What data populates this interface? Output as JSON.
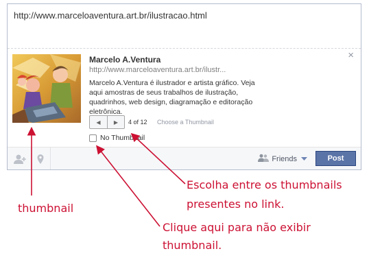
{
  "composer": {
    "status_text": "http://www.marceloaventura.art.br/ilustracao.html",
    "close_glyph": "×"
  },
  "preview": {
    "title": "Marcelo A.Ventura",
    "url": "http://www.marceloaventura.art.br/ilustr...",
    "description": "Marcelo A.Ventura é ilustrador e artista gráfico. Veja aqui amostras de seus trabalhos de ilustração, quadrinhos, web design, diagramação e editoração eletrônica.",
    "thumb_counter": "4 of 12",
    "choose_label": "Choose a Thumbnail",
    "no_thumbnail_label": "No Thumbnail",
    "no_thumbnail_checked": false,
    "prev_glyph": "◀",
    "next_glyph": "▶"
  },
  "footer": {
    "icons": [
      "add-friend-icon",
      "location-pin-icon",
      "friends-icon",
      "dropdown-arrow-icon"
    ],
    "audience_label": "Friends",
    "post_label": "Post"
  },
  "annotations": {
    "thumbnail": "thumbnail",
    "choose_line1": "Escolha entre os thumbnails",
    "choose_line2": "presentes no link.",
    "no_thumb_line1": "Clique aqui para não exibir",
    "no_thumb_line2": "thumbnail."
  },
  "colors": {
    "annotation": "#cc1133",
    "post_button": "#5b74a8",
    "border": "#b4bbcd"
  }
}
